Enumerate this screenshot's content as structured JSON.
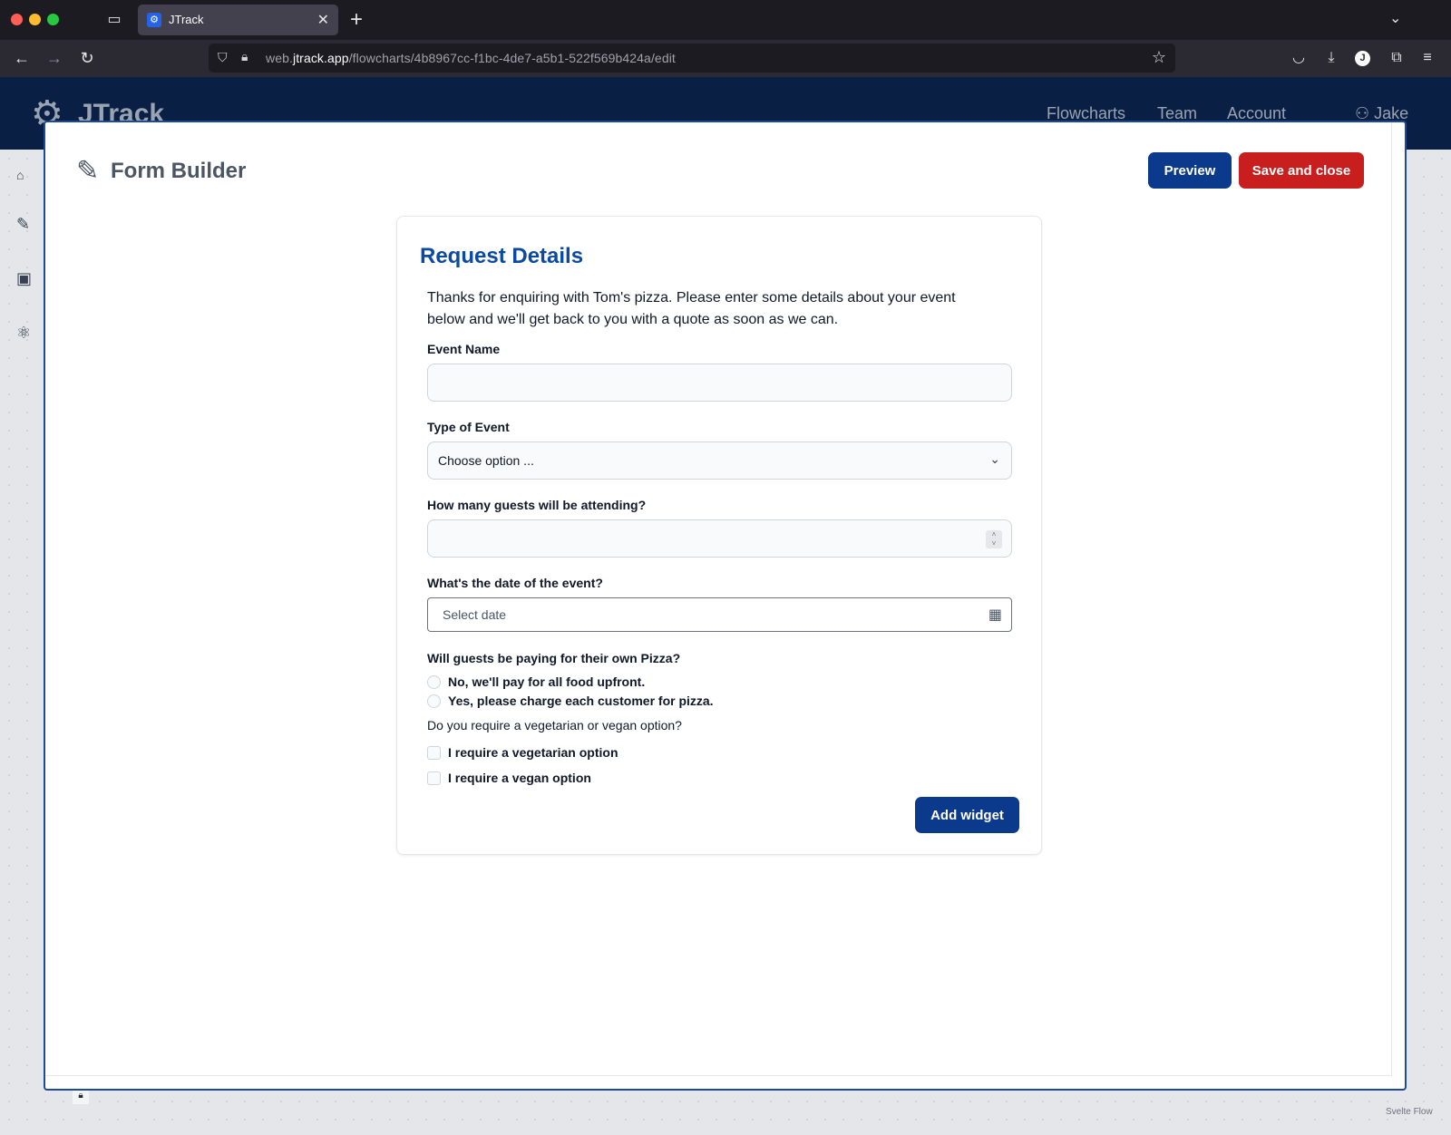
{
  "browser": {
    "tab_title": "JTrack",
    "url_prefix": "web.",
    "url_domain": "jtrack.app",
    "url_path": "/flowcharts/4b8967cc-f1bc-4de7-a5b1-522f569b424a/edit",
    "profile_initial": "J"
  },
  "app": {
    "logo": "JTrack",
    "nav": [
      "Flowcharts",
      "Team",
      "Account"
    ],
    "user": "Jake",
    "footer_brand": "Svelte Flow"
  },
  "modal": {
    "title": "Form Builder",
    "preview_label": "Preview",
    "save_label": "Save and close"
  },
  "form": {
    "title": "Request Details",
    "description": "Thanks for enquiring with Tom's pizza. Please enter some details about your event below and we'll get back to you with a quote as soon as we can.",
    "event_name_label": "Event Name",
    "event_name_value": "",
    "type_label": "Type of Event",
    "type_value": "Choose option ...",
    "guests_label": "How many guests will be attending?",
    "guests_value": "",
    "date_label": "What's the date of the event?",
    "date_placeholder": "Select date",
    "paying_label": "Will guests be paying for their own Pizza?",
    "paying_options": [
      "No, we'll pay for all food upfront.",
      "Yes, please charge each customer for pizza."
    ],
    "diet_label": "Do you require a vegetarian or vegan option?",
    "diet_options": [
      "I require a vegetarian option",
      "I require a vegan option"
    ],
    "add_widget_label": "Add widget"
  },
  "colors": {
    "primary": "#0b3a8c",
    "danger": "#c81e1e",
    "heading": "#0b4aa2",
    "header_bg": "#0a1f44"
  }
}
